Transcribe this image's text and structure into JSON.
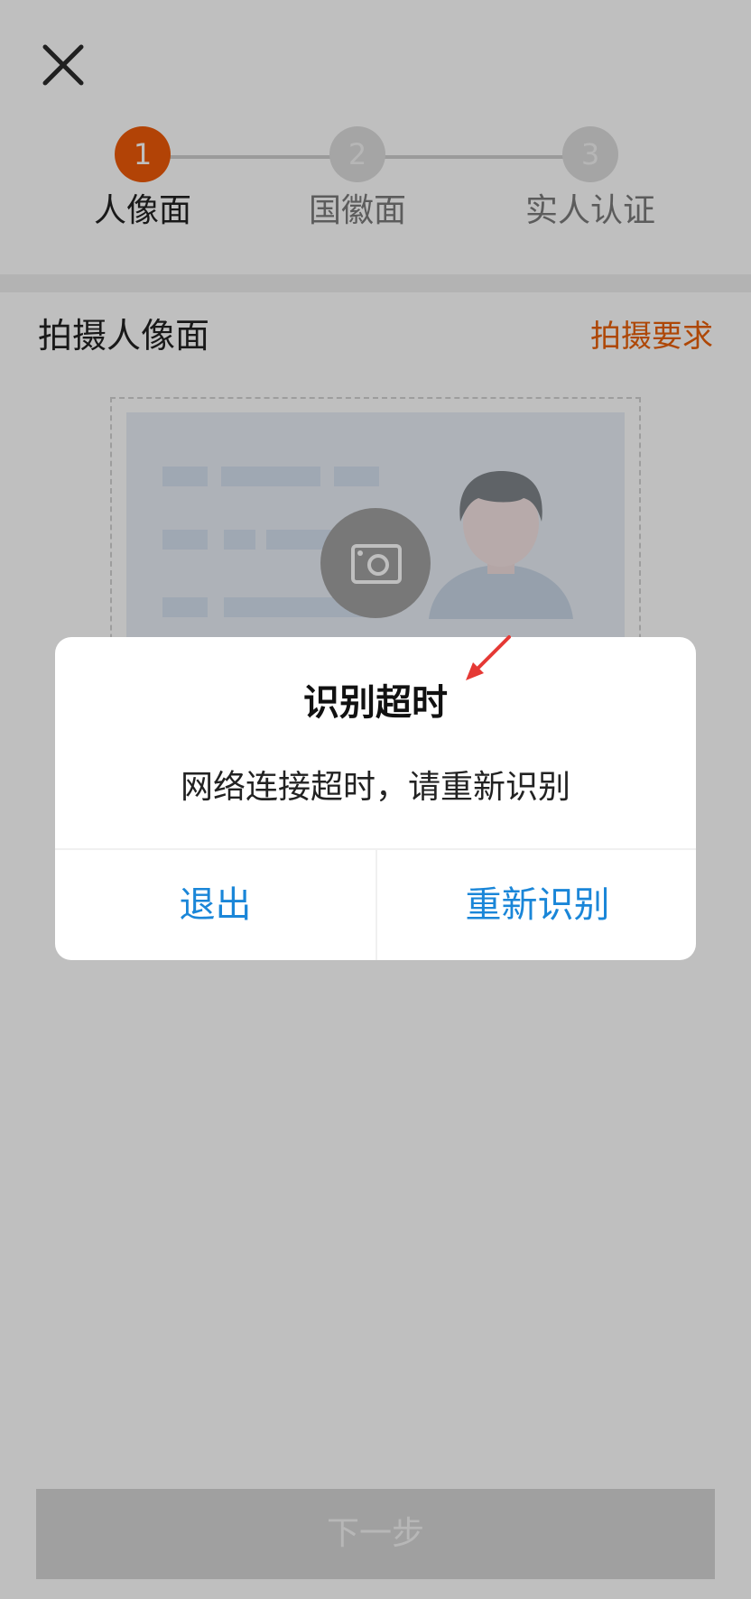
{
  "header": {
    "close_icon": "close-icon"
  },
  "stepper": {
    "steps": [
      {
        "number": "1",
        "label": "人像面",
        "state": "active"
      },
      {
        "number": "2",
        "label": "国徽面",
        "state": "inactive"
      },
      {
        "number": "3",
        "label": "实人认证",
        "state": "inactive"
      }
    ]
  },
  "section": {
    "title": "拍摄人像面",
    "link": "拍摄要求"
  },
  "camera": {
    "icon": "camera-icon"
  },
  "bottom": {
    "next_label": "下一步"
  },
  "dialog": {
    "title": "识别超时",
    "message": "网络连接超时，请重新识别",
    "exit_label": "退出",
    "retry_label": "重新识别"
  },
  "colors": {
    "accent": "#ee5a08",
    "link": "#1a86d8",
    "annotation": "#e53935"
  }
}
